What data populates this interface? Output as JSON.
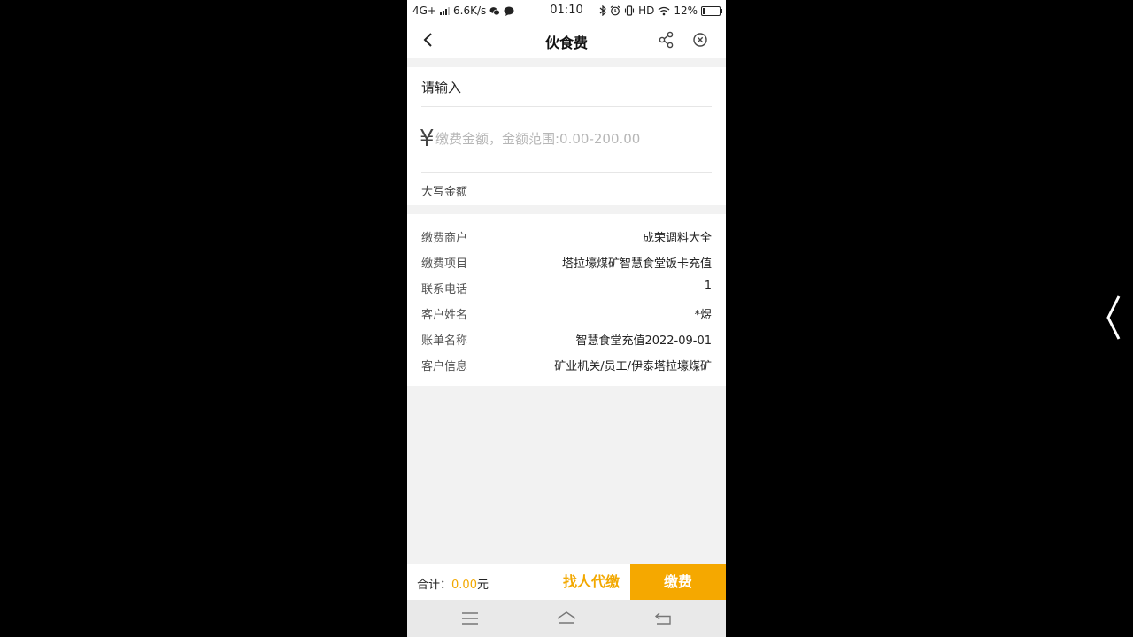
{
  "status": {
    "network": "4G+",
    "speed": "6.6K/s",
    "time": "01:10",
    "hd": "HD",
    "battery": "12%",
    "battery_level": 0.12
  },
  "nav": {
    "title": "伙食费"
  },
  "payment": {
    "input_label": "请输入",
    "currency_symbol": "¥",
    "amount_placeholder": "缴费金额，金额范围:0.00-200.00",
    "capital_label": "大写金额"
  },
  "details": [
    {
      "label": "缴费商户",
      "value": "成荣调料大全"
    },
    {
      "label": "缴费项目",
      "value": "塔拉壕煤矿智慧食堂饭卡充值"
    },
    {
      "label": "联系电话",
      "value": "1"
    },
    {
      "label": "客户姓名",
      "value": "*煜"
    },
    {
      "label": "账单名称",
      "value": "智慧食堂充值2022-09-01"
    },
    {
      "label": "客户信息",
      "value": "矿业机关/员工/伊泰塔拉壕煤矿"
    }
  ],
  "footer": {
    "total_label": "合计：",
    "total_amount": "0.00",
    "total_unit": "元",
    "proxy_pay_label": "找人代缴",
    "pay_label": "缴费"
  },
  "icons": {
    "back": "chevron-left-icon",
    "share": "share-icon",
    "close": "close-circle-icon",
    "menu": "menu-icon",
    "home": "home-icon",
    "return": "return-icon"
  },
  "colors": {
    "accent": "#f5a800",
    "accent_text": "#f2a800"
  }
}
